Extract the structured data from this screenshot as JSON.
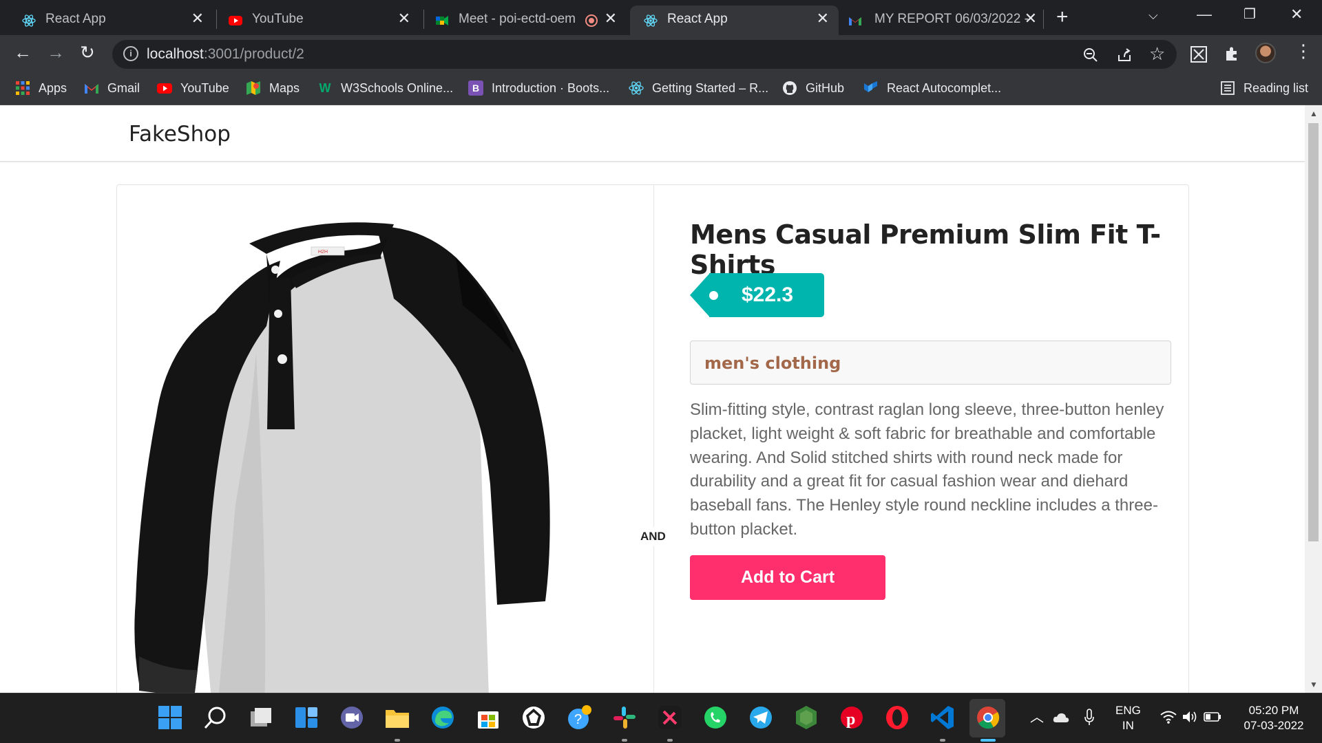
{
  "browser": {
    "tabs": [
      {
        "title": "React App",
        "icon": "react-icon",
        "active": false
      },
      {
        "title": "YouTube",
        "icon": "youtube-icon",
        "active": false
      },
      {
        "title": "Meet - poi-ectd-oem",
        "icon": "meet-icon",
        "active": false
      },
      {
        "title": "React App",
        "icon": "react-icon",
        "active": true
      },
      {
        "title": "MY REPORT 06/03/2022 -",
        "icon": "gmail-icon",
        "active": false
      }
    ],
    "url_host": "localhost",
    "url_path": ":3001/product/2",
    "bookmarks": [
      {
        "label": "Apps",
        "icon": "apps-grid-icon"
      },
      {
        "label": "Gmail",
        "icon": "gmail-icon"
      },
      {
        "label": "YouTube",
        "icon": "youtube-icon"
      },
      {
        "label": "Maps",
        "icon": "maps-icon"
      },
      {
        "label": "W3Schools Online...",
        "icon": "w3schools-icon"
      },
      {
        "label": "Introduction · Boots...",
        "icon": "bootstrap-icon"
      },
      {
        "label": "Getting Started – R...",
        "icon": "react-icon"
      },
      {
        "label": "GitHub",
        "icon": "github-icon"
      },
      {
        "label": "React Autocomplet...",
        "icon": "mui-icon"
      }
    ],
    "reading_list": "Reading list"
  },
  "app": {
    "brand": "FakeShop",
    "separator_label": "AND",
    "product": {
      "title": "Mens Casual Premium Slim Fit T-Shirts",
      "price": "$22.3",
      "category": "men's clothing",
      "description": "Slim-fitting style, contrast raglan long sleeve, three-button henley placket, light weight & soft fabric for breathable and comfortable wearing. And Solid stitched shirts with round neck made for durability and a great fit for casual fashion wear and diehard baseball fans. The Henley style round neckline includes a three-button placket.",
      "add_to_cart": "Add to Cart",
      "shirt_label": "H2H"
    }
  },
  "taskbar": {
    "language": "ENG",
    "region": "IN",
    "time": "05:20 PM",
    "date": "07-03-2022"
  },
  "colors": {
    "price_tag": "#00b5ad",
    "cart_button": "#ff2f6e",
    "category_text": "#a3684a",
    "chrome_dark": "#202124",
    "chrome_toolbar": "#35363a"
  }
}
